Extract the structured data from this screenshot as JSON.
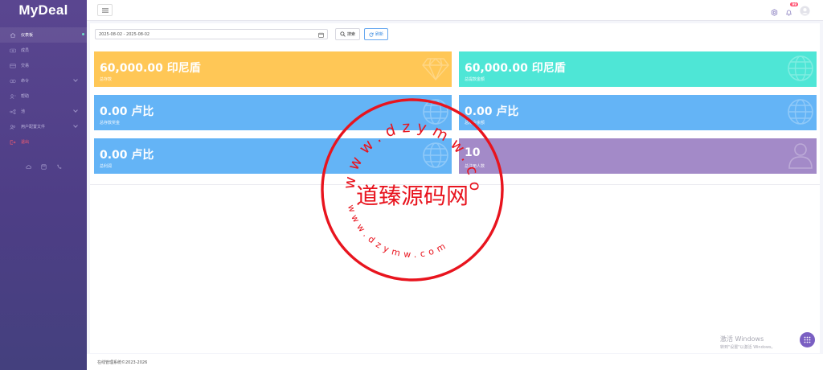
{
  "brand": {
    "logo": "MyDeal"
  },
  "sidebar": {
    "items": [
      {
        "label": "仪表板",
        "icon": "home-icon",
        "active": true
      },
      {
        "label": "成员",
        "icon": "users-icon"
      },
      {
        "label": "交易",
        "icon": "card-icon"
      },
      {
        "label": "命令",
        "icon": "layers-icon",
        "has_children": true
      },
      {
        "label": "帮助",
        "icon": "person-icon"
      },
      {
        "label": "池",
        "icon": "share-icon",
        "has_children": true
      },
      {
        "label": "用户配置文件",
        "icon": "profile-icon",
        "has_children": true
      },
      {
        "label": "退出",
        "icon": "logout-icon",
        "danger": true
      }
    ],
    "tools": [
      "cloud-icon",
      "save-icon",
      "phone-icon"
    ]
  },
  "topbar": {
    "notification_count": "99"
  },
  "filter": {
    "date_range": "2025-08-02 - 2025-08-02",
    "search_label": "搜索",
    "refresh_label": "刷新"
  },
  "cards": [
    {
      "value": "60,000.00 印尼盾",
      "label": "总存款",
      "color": "#ffc756",
      "icon": "diamond-icon"
    },
    {
      "value": "60,000.00 印尼盾",
      "label": "总提款金额",
      "color": "#4ee6d6",
      "icon": "globe-icon"
    },
    {
      "value": "0.00 卢比",
      "label": "总存款奖金",
      "color": "#64b4f6",
      "icon": "globe-icon"
    },
    {
      "value": "0.00 卢比",
      "label": "总用户余额",
      "color": "#64b4f6",
      "icon": "globe-icon"
    },
    {
      "value": "0.00 卢比",
      "label": "总利润",
      "color": "#64b4f6",
      "icon": "globe-icon"
    },
    {
      "value": "10",
      "label": "总注册人数",
      "color": "#a38ac8",
      "icon": "user-icon"
    }
  ],
  "footer": {
    "text": "在线管理系统©2023-2026"
  },
  "watermark": {
    "line1": "激活 Windows",
    "line2": "转到\"设置\"以激活 Windows。"
  },
  "stamp": {
    "main_text": "道臻源码网",
    "ring_text_top": "www.dzymw.com",
    "ring_text_bottom": "www.dzymw.com"
  }
}
